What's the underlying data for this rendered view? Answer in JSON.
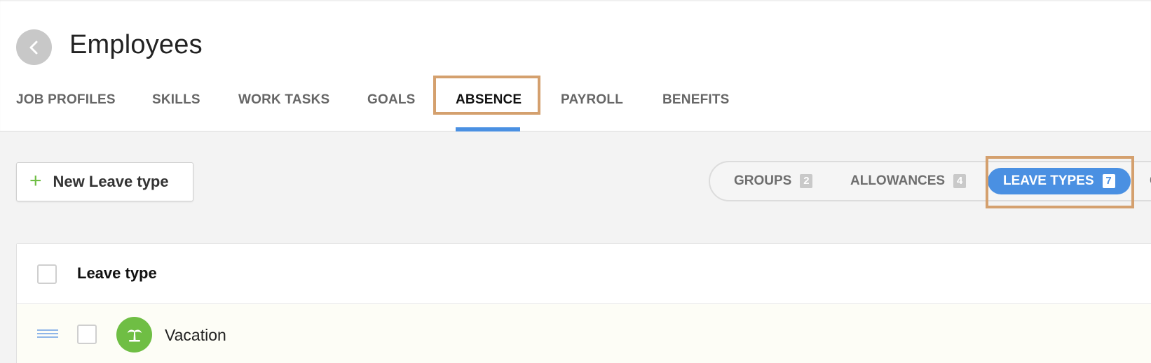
{
  "header": {
    "title": "Employees",
    "back_icon": "chevron-left-icon"
  },
  "tabs": [
    {
      "label": "JOB PROFILES"
    },
    {
      "label": "SKILLS"
    },
    {
      "label": "WORK TASKS"
    },
    {
      "label": "GOALS"
    },
    {
      "label": "ABSENCE",
      "active": true
    },
    {
      "label": "PAYROLL"
    },
    {
      "label": "BENEFITS"
    }
  ],
  "toolbar": {
    "new_button_icon": "plus-icon",
    "new_button_label": "New Leave type"
  },
  "segments": [
    {
      "label": "GROUPS",
      "count": "2"
    },
    {
      "label": "ALLOWANCES",
      "count": "4"
    },
    {
      "label": "LEAVE TYPES",
      "count": "7",
      "active": true
    },
    {
      "label": "C"
    }
  ],
  "table": {
    "header_label": "Leave type",
    "rows": [
      {
        "label": "Vacation",
        "icon": "palm-tree-icon",
        "icon_color": "#6fbe44"
      }
    ]
  },
  "colors": {
    "accent": "#4a90e2",
    "highlight": "#d4a06e",
    "success": "#6fbe44"
  }
}
